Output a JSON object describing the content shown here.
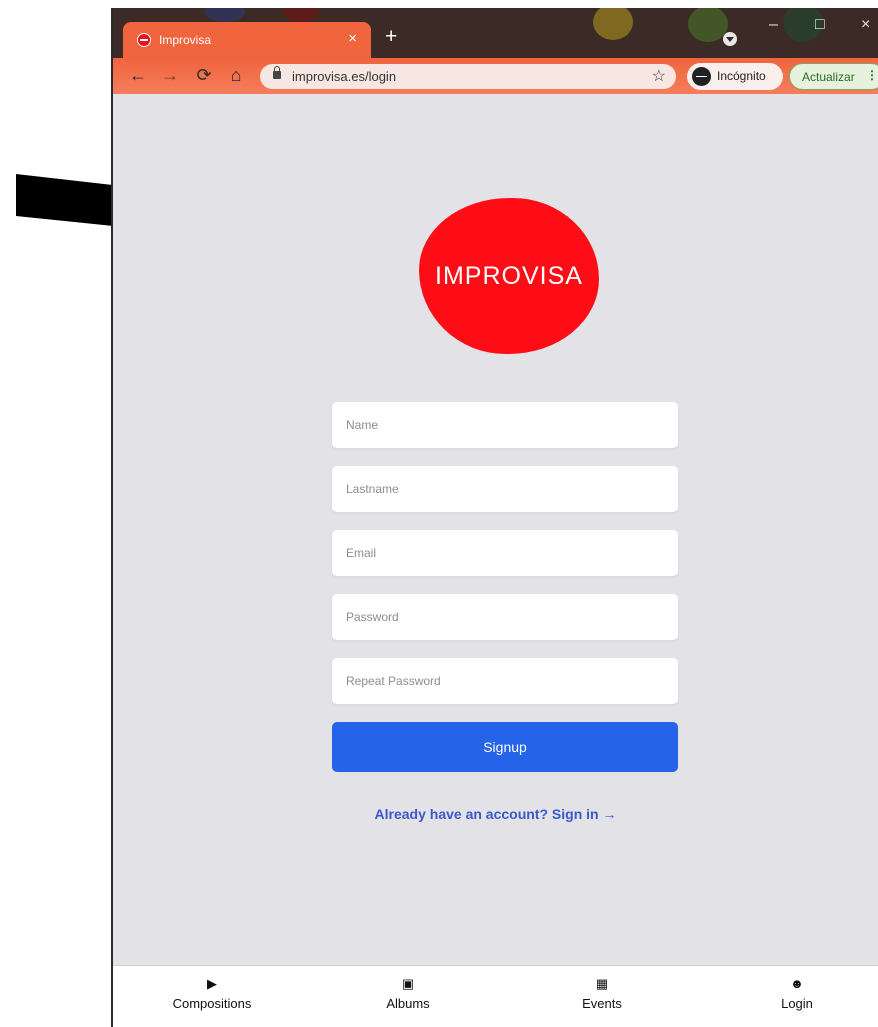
{
  "browser": {
    "tab": {
      "title": "Improvisa",
      "close_symbol": "×",
      "favicon": "improvisa-favicon"
    },
    "new_tab_symbol": "+",
    "window_controls": {
      "minimize": "–",
      "maximize": "□",
      "close": "×"
    },
    "toolbar": {
      "back": "←",
      "forward": "→",
      "reload": "⟳",
      "home": "⌂",
      "url": "improvisa.es/login",
      "bookmark_star": "☆",
      "incognito_label": "Incógnito",
      "update_label": "Actualizar",
      "menu_symbol": "⋮"
    },
    "colors": {
      "tab_accent": "#f0643e"
    }
  },
  "page": {
    "logo_text": "IMPROVISA",
    "brand_color": "#ff0d17",
    "form": {
      "name_placeholder": "Name",
      "lastname_placeholder": "Lastname",
      "email_placeholder": "Email",
      "password_placeholder": "Password",
      "repeat_password_placeholder": "Repeat Password",
      "submit_label": "Signup",
      "submit_color": "#2563e8"
    },
    "signin_link": "Already have an account? Sign in →"
  },
  "bottom_nav": {
    "items": [
      {
        "label": "Compositions",
        "icon": "play-icon",
        "glyph": "▶"
      },
      {
        "label": "Albums",
        "icon": "images-icon",
        "glyph": "▣"
      },
      {
        "label": "Events",
        "icon": "calendar-icon",
        "glyph": "▦"
      },
      {
        "label": "Login",
        "icon": "user-circle-icon",
        "glyph": "☻"
      }
    ]
  }
}
